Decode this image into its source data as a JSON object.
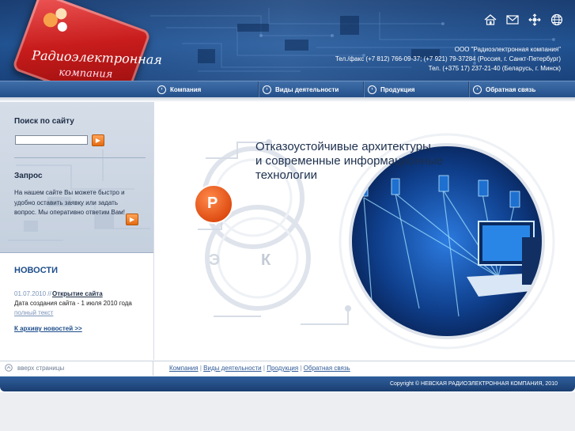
{
  "header": {
    "logo_text_line1": "Радиоэлектронная",
    "logo_text_line2": "компания",
    "contact_line1": "ООО \"Радиоэлектронная компания\"",
    "contact_line2": "Тел./факс (+7 812) 766-09-37; (+7 921) 79-37284 (Россия, г. Санкт-Петербург)",
    "contact_line3": "Тел. (+375 17) 237-21-40 (Беларусь, г. Минск)",
    "icons": [
      "home-icon",
      "mail-icon",
      "sitemap-icon",
      "globe-icon"
    ]
  },
  "nav": {
    "items": [
      {
        "label": "Компания"
      },
      {
        "label": "Виды деятельности"
      },
      {
        "label": "Продукция"
      },
      {
        "label": "Обратная связь"
      }
    ]
  },
  "sidebar": {
    "search_title": "Поиск по сайту",
    "search_value": "",
    "request_title": "Запрос",
    "request_text": "На нашем сайте Вы можете быстро и удобно оставить заявку или задать вопрос. Мы оперативно ответим Вам!"
  },
  "news": {
    "title": "НОВОСТИ",
    "items": [
      {
        "date": "01.07.2010 //",
        "headline": "Открытие сайта",
        "text": "Дата создания сайта - 1 июля 2010 года",
        "more": "полный текст"
      }
    ],
    "archive": "К архиву новостей >>"
  },
  "hero": {
    "line1": "Отказоустойчивые архитектуры",
    "line2": "и современные информационные",
    "line3": "технологии",
    "letter_r": "Р",
    "letter_e": "Э",
    "letter_k": "К"
  },
  "footer": {
    "to_top": "вверх страницы",
    "links": [
      "Компания",
      "Виды деятельности",
      "Продукция",
      "Обратная связь"
    ],
    "separator": "|",
    "copyright": "Copyright © НЕВСКАЯ РАДИОЭЛЕКТРОННАЯ КОМПАНИЯ, 2010"
  },
  "colors": {
    "header_blue": "#1e4f8e",
    "accent_orange": "#e36a12",
    "logo_red": "#c81c1c",
    "nav_blue": "#24508a"
  }
}
